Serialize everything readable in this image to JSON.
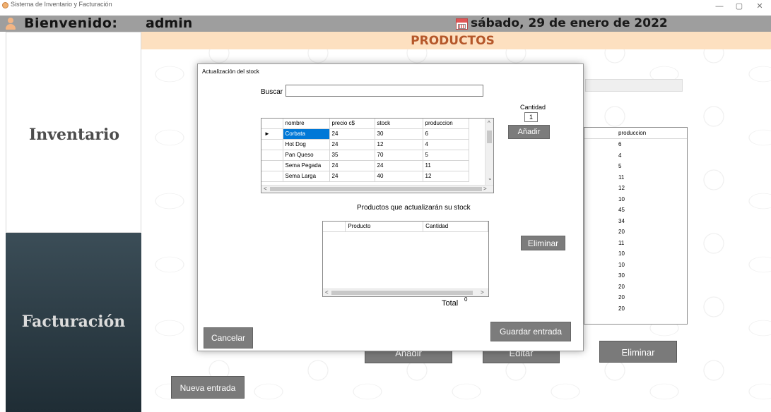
{
  "window": {
    "title": "Sistema de Inventario y Facturación",
    "minimize": "—",
    "maximize": "▢",
    "close": "✕"
  },
  "header": {
    "welcome": "Bienvenido:",
    "username": "admin",
    "date": "sábado, 29 de enero de 2022"
  },
  "sidebar": {
    "inventario": "Inventario",
    "facturacion": "Facturación"
  },
  "section": {
    "title": "PRODUCTOS"
  },
  "background": {
    "grid_header": "produccion",
    "grid_values": [
      "6",
      "4",
      "5",
      "11",
      "12",
      "10",
      "45",
      "34",
      "20",
      "11",
      "10",
      "10",
      "30",
      "20",
      "20",
      "20"
    ],
    "add_button": "Añadir",
    "edit_button": "Editar",
    "delete_button": "Eliminar",
    "new_entry_button": "Nueva entrada"
  },
  "dialog": {
    "title": "Actualización del stock",
    "search_label": "Buscar",
    "search_value": "",
    "quantity_label": "Cantidad",
    "quantity_value": "1",
    "add_button": "Añadir",
    "products_grid": {
      "columns": [
        "nombre",
        "precio c$",
        "stock",
        "produccion"
      ],
      "rows": [
        [
          "Corbata",
          "24",
          "30",
          "6"
        ],
        [
          "Hot Dog",
          "24",
          "12",
          "4"
        ],
        [
          "Pan Queso",
          "35",
          "70",
          "5"
        ],
        [
          "Sema Pegada",
          "24",
          "24",
          "11"
        ],
        [
          "Sema Larga",
          "24",
          "40",
          "12"
        ]
      ]
    },
    "update_label": "Productos que actualizarán su stock",
    "update_grid": {
      "columns": [
        "Producto",
        "Cantidad"
      ]
    },
    "delete_button": "Eliminar",
    "total_label": "Total",
    "total_value": "0",
    "cancel_button": "Cancelar",
    "save_button": "Guardar entrada"
  },
  "colors": {
    "header_bg": "#9e9e9e",
    "title_bar_bg": "#fde0c0",
    "title_text": "#b5572a",
    "sidebar_dark": "#2c3c45",
    "button_gray": "#7c7c7c",
    "selection_blue": "#0078d7"
  }
}
